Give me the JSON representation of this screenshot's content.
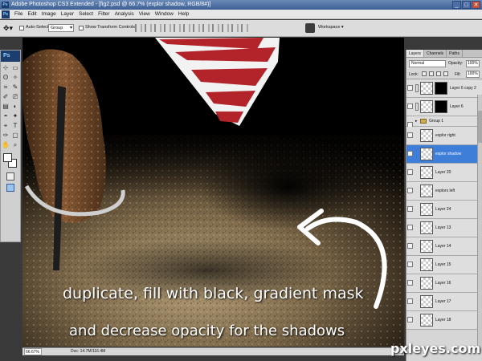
{
  "titlebar": {
    "text": "Adobe Photoshop CS3 Extended - [fig2.psd @ 66.7% (explor shadow, RGB/8#)]",
    "controls": [
      "_",
      "□",
      "✕"
    ]
  },
  "menubar": {
    "items": [
      "File",
      "Edit",
      "Image",
      "Layer",
      "Select",
      "Filter",
      "Analysis",
      "View",
      "Window",
      "Help"
    ]
  },
  "options": {
    "auto_select_label": "Auto-Select:",
    "auto_select_value": "Group",
    "show_transform_label": "Show Transform Controls",
    "workspace_label": "Workspace ▾"
  },
  "toolbox": {
    "badge": "Ps",
    "tools": [
      "⊹",
      "▭",
      "ʘ",
      "✧",
      "⌗",
      "✎",
      "✐",
      "⎚",
      "▤",
      "◐",
      "◓",
      "✦",
      "⌖",
      "T",
      "✑",
      "▢",
      "✋",
      "⌕"
    ]
  },
  "canvas": {
    "caption_line1": "duplicate, fill with black, gradient mask",
    "caption_line2": "and decrease opacity for the shadows"
  },
  "statusbar": {
    "zoom": "66.67%",
    "doc": "Doc: 14.7M/116.4M"
  },
  "layers_panel": {
    "tabs": [
      "Layers",
      "Channels",
      "Paths"
    ],
    "blend_mode": "Normal",
    "opacity_label": "Opacity:",
    "opacity_value": "100%",
    "lock_label": "Lock:",
    "fill_label": "Fill:",
    "fill_value": "100%",
    "layers": [
      {
        "name": "Layer 6 copy 2",
        "masked": true
      },
      {
        "name": "Layer 6",
        "masked": true
      },
      {
        "name": "Group 1",
        "group": true
      },
      {
        "name": "explor right"
      },
      {
        "name": "explor shadow",
        "selected": true
      },
      {
        "name": "Layer 20"
      },
      {
        "name": "explorx left"
      },
      {
        "name": "Layer 24"
      },
      {
        "name": "Layer 13"
      },
      {
        "name": "Layer 14"
      },
      {
        "name": "Layer 15"
      },
      {
        "name": "Layer 16"
      },
      {
        "name": "Layer 17"
      },
      {
        "name": "Layer 18"
      }
    ]
  },
  "watermark": "pxleyes.com",
  "colors": {
    "selected_layer": "#3f7ed8",
    "titlebar": "#3c5f93"
  }
}
